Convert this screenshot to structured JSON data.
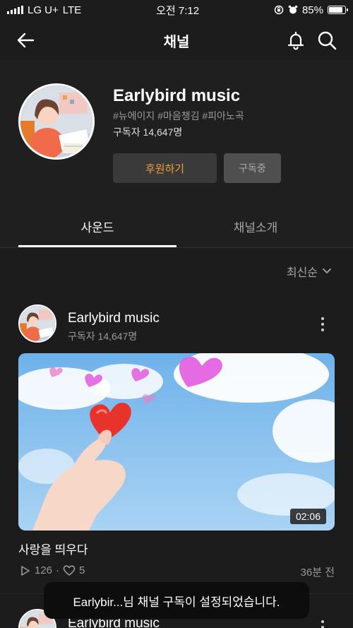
{
  "status_bar": {
    "carrier": "LG U+",
    "network": "LTE",
    "time": "오전 7:12",
    "battery_text": "85%",
    "battery_level": 0.85
  },
  "nav": {
    "title": "채널",
    "back_icon": "arrow-left-icon",
    "bell_icon": "bell-icon",
    "search_icon": "search-icon"
  },
  "channel": {
    "name": "Earlybird music",
    "tags": "#뉴에이지 #마음챙김 #피아노곡",
    "subscribers": "구독자 14,647명",
    "support_button": "후원하기",
    "subscribed_button": "구독중"
  },
  "tabs": [
    {
      "label": "사운드",
      "active": true
    },
    {
      "label": "채널소개",
      "active": false
    }
  ],
  "sort": {
    "label": "최신순",
    "icon": "chevron-down-icon"
  },
  "posts": [
    {
      "author": "Earlybird music",
      "subscribers": "구독자 14,647명",
      "duration": "02:06",
      "title": "사랑을 띄우다",
      "plays": "126",
      "likes": "5",
      "time_ago": "36분 전"
    },
    {
      "author": "Earlybird music"
    }
  ],
  "toast": {
    "message": "Earlybir...님 채널 구독이 설정되었습니다."
  },
  "colors": {
    "background": "#1c1c1c",
    "accent": "#f0a037",
    "muted_text": "#9a9a9a",
    "sky": "#8fc3ee",
    "heart": "#e8322c",
    "heart_magenta": "#e25be0"
  }
}
